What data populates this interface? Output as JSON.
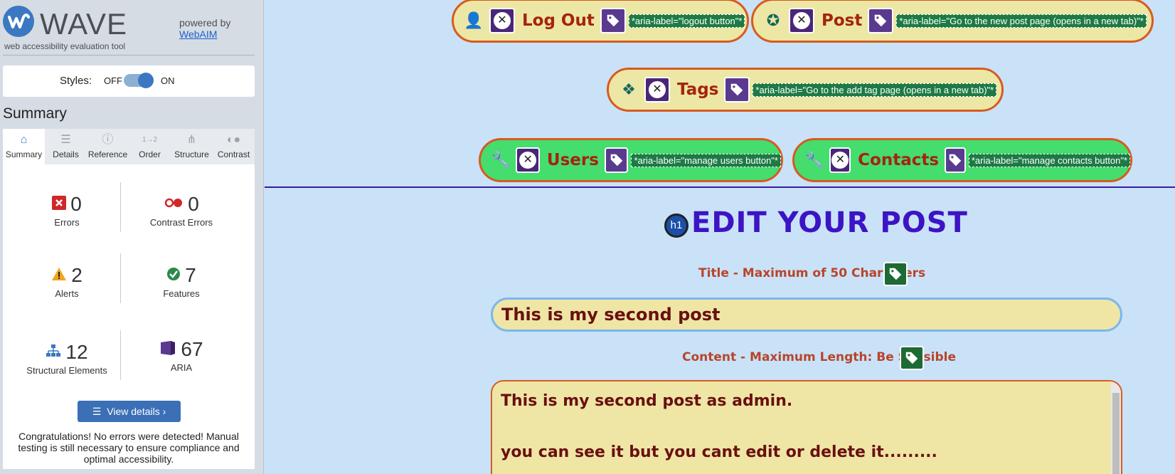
{
  "wave": {
    "title": "WAVE",
    "subtitle": "web accessibility evaluation tool",
    "powered_by": "powered by",
    "webaim": "WebAIM",
    "styles_label": "Styles:",
    "styles_off": "OFF",
    "styles_on": "ON",
    "summary_heading": "Summary",
    "tabs": [
      {
        "label": "Summary",
        "icon": "home-icon"
      },
      {
        "label": "Details",
        "icon": "list-icon"
      },
      {
        "label": "Reference",
        "icon": "info-icon"
      },
      {
        "label": "Order",
        "icon": "order-icon"
      },
      {
        "label": "Structure",
        "icon": "structure-icon"
      },
      {
        "label": "Contrast",
        "icon": "contrast-icon"
      }
    ],
    "stats": {
      "errors": {
        "value": "0",
        "label": "Errors"
      },
      "contrast_errors": {
        "value": "0",
        "label": "Contrast Errors"
      },
      "alerts": {
        "value": "2",
        "label": "Alerts"
      },
      "features": {
        "value": "7",
        "label": "Features"
      },
      "structural": {
        "value": "12",
        "label": "Structural Elements"
      },
      "aria": {
        "value": "67",
        "label": "ARIA"
      }
    },
    "view_details": "View details ›",
    "congrats": "Congratulations! No errors were detected! Manual testing is still necessary to ensure compliance and optimal accessibility."
  },
  "nav": {
    "logout": {
      "label": "Log Out",
      "aria": "*aria-label=\"logout button\"*"
    },
    "post": {
      "label": "Post",
      "aria": "*aria-label=\"Go to the new post page (opens in a new tab)\"*"
    },
    "tags": {
      "label": "Tags",
      "aria": "*aria-label=\"Go to the add tag page (opens in a new tab)\"*"
    },
    "users": {
      "label": "Users",
      "aria": "*aria-label=\"manage users button\"*"
    },
    "contacts": {
      "label": "Contacts",
      "aria": "*aria-label=\"manage contacts button\"*"
    }
  },
  "form": {
    "h1_badge": "h1",
    "heading": "EDIT YOUR POST",
    "title_label": "Title - Maximum of 50 Characters",
    "title_value": "This is my second post",
    "content_label": "Content - Maximum Length: Be Sensible",
    "content_line1": "This is my second post as admin.",
    "content_line2": "you can see it but you cant edit or delete it........."
  },
  "colors": {
    "wave_blue": "#3b78c2",
    "pill_border": "#d85a20",
    "pill_yellow": "#ede7a5",
    "pill_green": "#44dd6e",
    "heading_purple": "#3c14c4",
    "page_bg": "#c9e2f8"
  }
}
